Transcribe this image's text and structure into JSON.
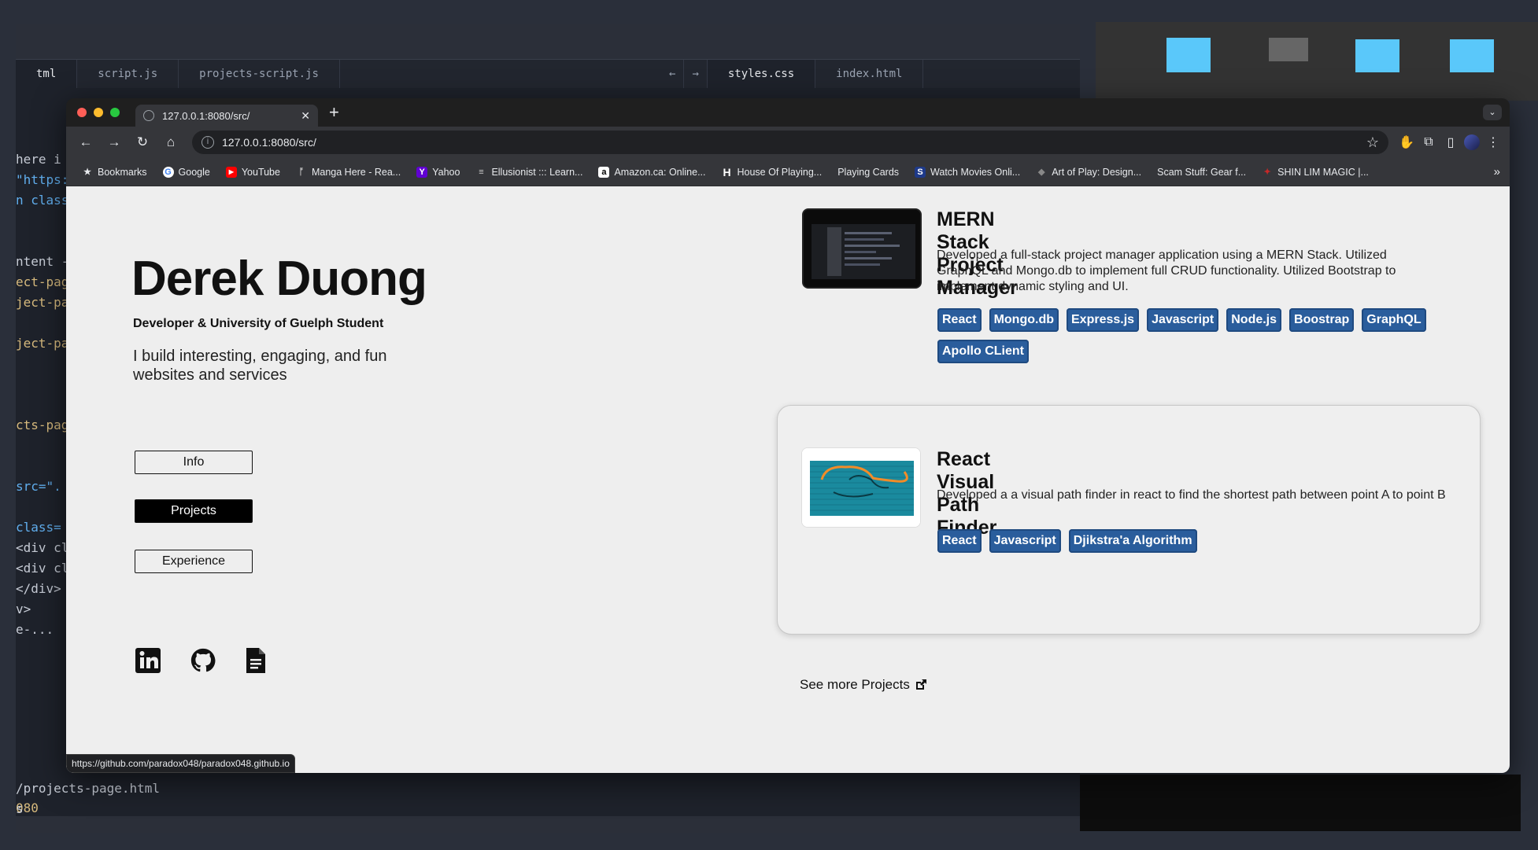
{
  "editor": {
    "tabs": [
      "tml",
      "script.js",
      "projects-script.js"
    ],
    "right_tabs": [
      "styles.css",
      "index.html"
    ],
    "code_lines": [
      "here i",
      "\"https:",
      "n class",
      "",
      "",
      "ntent -",
      "ect-pag",
      "ject-pa",
      "",
      "ject-pa",
      "",
      "",
      "",
      "cts-pag",
      "",
      "",
      "src=\".",
      "",
      "class=",
      "<div cl",
      "<div cl",
      "</div>",
      "v>",
      "e-..."
    ],
    "bottom_lines": [
      "080",
      "",
      "/projects-page.html",
      "s"
    ]
  },
  "browser": {
    "tab_title": "127.0.0.1:8080/src/",
    "url": "127.0.0.1:8080/src/",
    "bookmarks": [
      {
        "label": "Bookmarks",
        "icon": "star-icon"
      },
      {
        "label": "Google",
        "icon": "google-icon"
      },
      {
        "label": "YouTube",
        "icon": "youtube-icon"
      },
      {
        "label": "Manga Here - Rea...",
        "icon": "manga-icon"
      },
      {
        "label": "Yahoo",
        "icon": "yahoo-icon"
      },
      {
        "label": "Ellusionist ::: Learn...",
        "icon": "ellusionist-icon"
      },
      {
        "label": "Amazon.ca: Online...",
        "icon": "amazon-icon"
      },
      {
        "label": "House Of Playing...",
        "icon": "house-icon"
      },
      {
        "label": "Playing Cards",
        "icon": ""
      },
      {
        "label": "Watch Movies Onli...",
        "icon": "movies-icon"
      },
      {
        "label": "Art of Play: Design...",
        "icon": "artofplay-icon"
      },
      {
        "label": "Scam Stuff: Gear f...",
        "icon": ""
      },
      {
        "label": "SHIN LIM MAGIC |...",
        "icon": "shinlim-icon"
      }
    ],
    "status_url": "https://github.com/paradox048/paradox048.github.io"
  },
  "hero": {
    "name": "Derek Duong",
    "subtitle": "Developer & University of Guelph Student",
    "tagline": "I build interesting, engaging, and fun websites and services"
  },
  "nav": {
    "info": "Info",
    "projects": "Projects",
    "experience": "Experience"
  },
  "projects": [
    {
      "title": "MERN Stack Project Manager",
      "description": "Developed a full-stack project manager application using a MERN Stack. Utilized GraphQL and Mongo.db to implement full CRUD functionality. Utilized Bootstrap to implement dynamic styling and UI.",
      "tags": [
        "React",
        "Mongo.db",
        "Express.js",
        "Javascript",
        "Node.js",
        "Boostrap",
        "GraphQL",
        "Apollo CLient"
      ]
    },
    {
      "title": "React Visual Path Finder",
      "description": "Developed a a visual path finder in react to find the shortest path between point A to point B",
      "tags": [
        "React",
        "Javascript",
        "Djikstra'a Algorithm"
      ]
    }
  ],
  "see_more": "See more Projects",
  "colors": {
    "tag_bg": "#2a5d9c",
    "page_bg": "#eeeeee",
    "accent_dark": "#000000"
  }
}
